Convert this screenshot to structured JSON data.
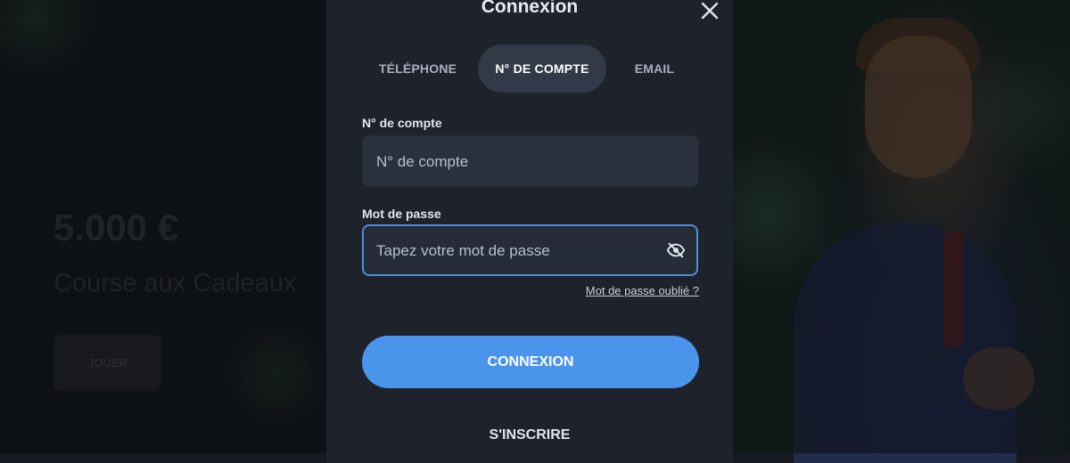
{
  "background": {
    "promo_amount": "5.000 €",
    "promo_title": "Course aux Cadeaux",
    "promo_button_label": "JOUER"
  },
  "modal": {
    "title": "Connexion",
    "close_icon": "close-icon",
    "tabs": [
      {
        "label": "TÉLÉPHONE",
        "active": false
      },
      {
        "label": "N° DE COMPTE",
        "active": true
      },
      {
        "label": "EMAIL",
        "active": false
      }
    ],
    "account_field": {
      "label": "N° de compte",
      "placeholder": "N° de compte",
      "value": ""
    },
    "password_field": {
      "label": "Mot de passe",
      "placeholder": "Tapez votre mot de passe",
      "value": "",
      "toggle_icon": "eye-off-icon"
    },
    "forgot_password_label": "Mot de passe oublié ?",
    "login_button_label": "CONNEXION",
    "register_label": "S'INSCRIRE"
  },
  "colors": {
    "modal_bg": "#1e222b",
    "accent": "#4a94ec",
    "field_bg": "#2a303c",
    "focus_border": "#4e8fd6"
  }
}
